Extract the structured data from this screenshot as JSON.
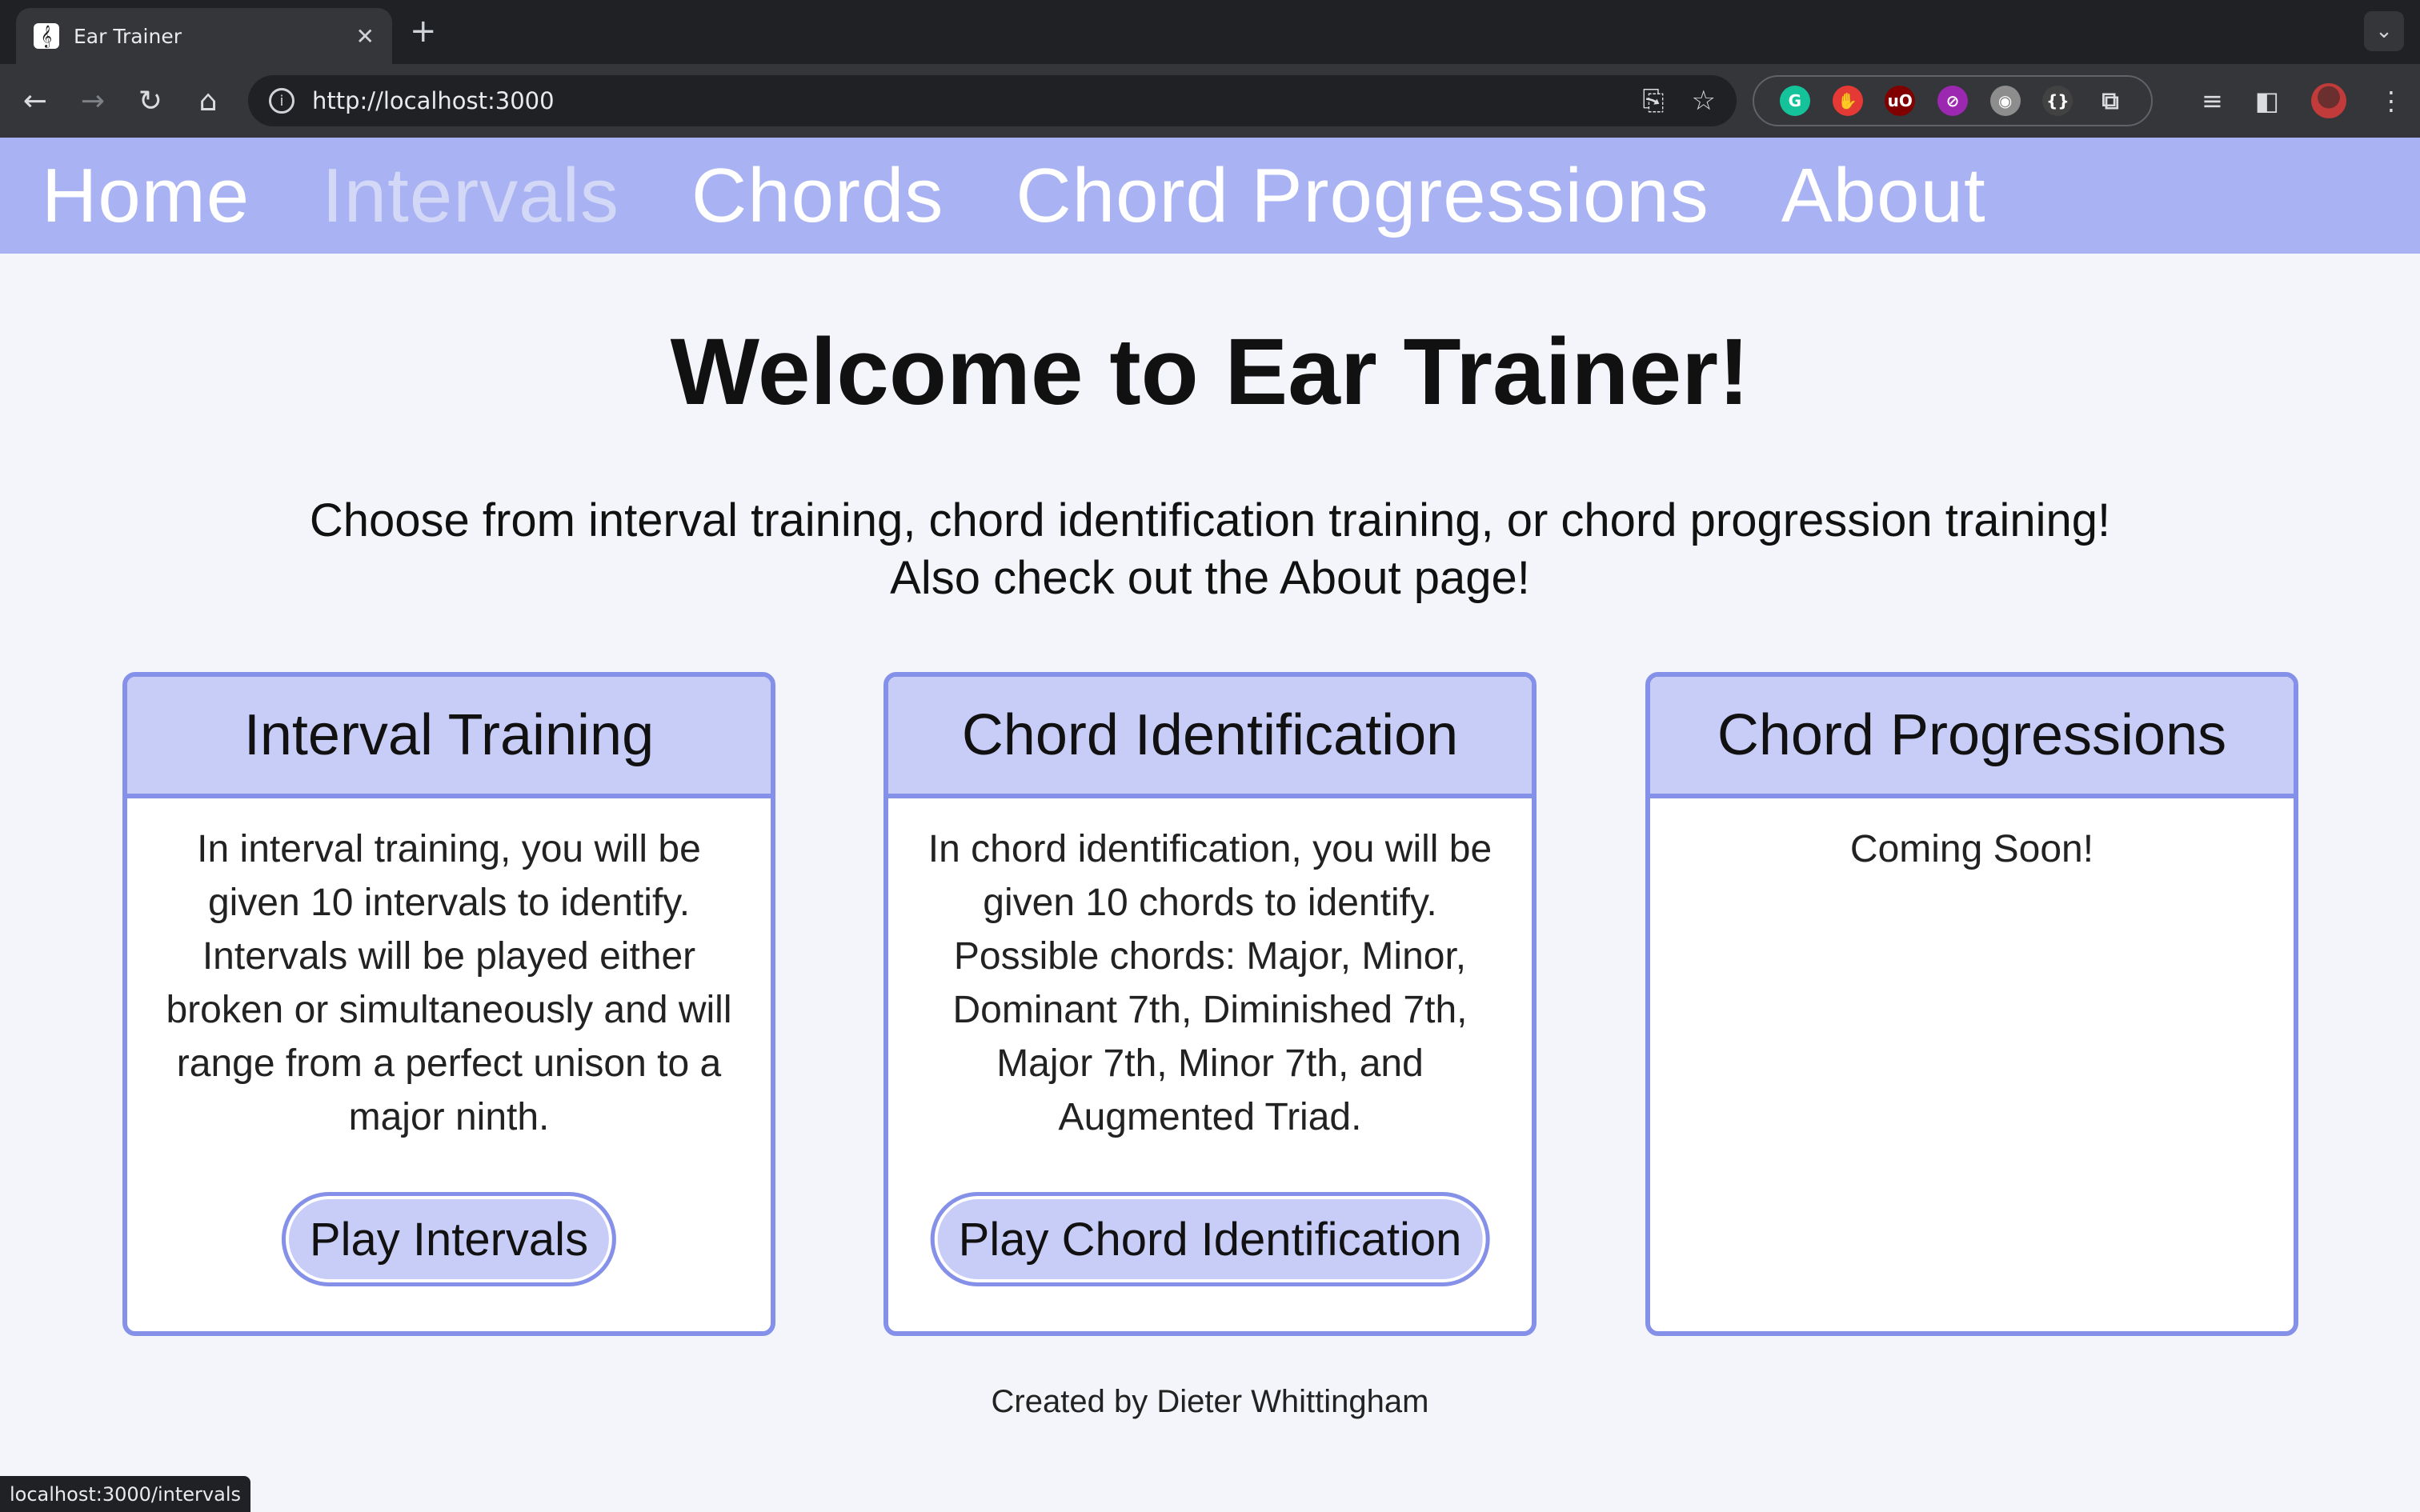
{
  "browser": {
    "tab_title": "Ear Trainer",
    "tab_favicon": "𝄞",
    "new_tab_label": "+",
    "url": "http://localhost:3000",
    "status_url": "localhost:3000/intervals",
    "extensions": [
      {
        "icon": "grammarly-icon",
        "glyph": "G",
        "color": "#15c39a"
      },
      {
        "icon": "adblock-icon",
        "glyph": "✋",
        "color": "#e53935"
      },
      {
        "icon": "ublock-icon",
        "glyph": "uO",
        "color": "#800000"
      },
      {
        "icon": "compass-icon",
        "glyph": "⊘",
        "color": "#9c27b0"
      },
      {
        "icon": "owl-icon",
        "glyph": "◉",
        "color": "#8d8d8d"
      },
      {
        "icon": "code-icon",
        "glyph": "{}",
        "color": "#424242"
      }
    ]
  },
  "nav": {
    "items": [
      {
        "label": "Home",
        "active": false
      },
      {
        "label": "Intervals",
        "active": true
      },
      {
        "label": "Chords",
        "active": false
      },
      {
        "label": "Chord Progressions",
        "active": false
      },
      {
        "label": "About",
        "active": false
      }
    ]
  },
  "main": {
    "headline": "Welcome to Ear Trainer!",
    "intro_line1": "Choose from interval training, chord identification training, or chord progression training!",
    "intro_line2": "Also check out the About page!",
    "cards": [
      {
        "title": "Interval Training",
        "body": "In interval training, you will be given 10 intervals to identify. Intervals will be played either broken or simultaneously and will range from a perfect unison to a major ninth.",
        "button": "Play Intervals"
      },
      {
        "title": "Chord Identification",
        "body": "In chord identification, you will be given 10 chords to identify. Possible chords: Major, Minor, Dominant 7th, Diminished 7th, Major 7th, Minor 7th, and Augmented Triad.",
        "button": "Play Chord Identification"
      },
      {
        "title": "Chord Progressions",
        "body": "Coming Soon!",
        "button": null
      }
    ],
    "footer": "Created by Dieter Whittingham"
  },
  "colors": {
    "nav_bg": "#a9b2f3",
    "card_border": "#8590e8",
    "card_header_bg": "#c8cdf8",
    "page_bg": "#f3f5fa"
  }
}
